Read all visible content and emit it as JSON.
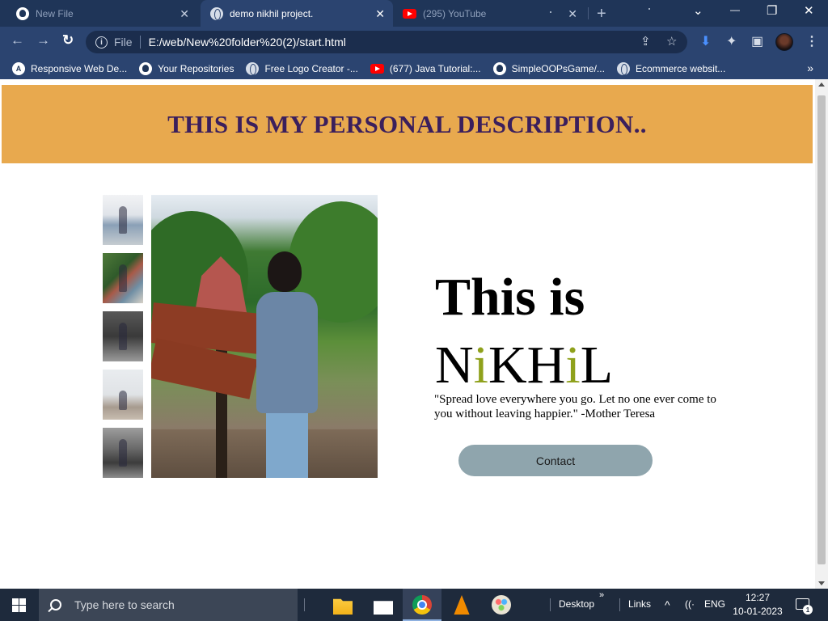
{
  "browser": {
    "tabs": [
      {
        "title": "New File",
        "icon": "github-icon",
        "active": false
      },
      {
        "title": "demo nikhil project.",
        "icon": "globe-icon",
        "active": true
      },
      {
        "title": "(295) YouTube",
        "icon": "youtube-icon",
        "active": false
      }
    ],
    "tab_close_glyph": "✕",
    "new_tab_glyph": "+",
    "window_controls": {
      "dropdown": "⌄",
      "minimize": "—",
      "restore": "❐",
      "close": "✕"
    },
    "nav": {
      "back": "←",
      "forward": "→",
      "reload": "↻"
    },
    "address_bar": {
      "scheme": "File",
      "url": "E:/web/New%20folder%20(2)/start.html"
    },
    "toolbar_icons": {
      "share": "⇪",
      "bookmark_star": "☆",
      "download": "⬇",
      "extensions": "✦",
      "side_panel": "▣",
      "menu": "⋮"
    },
    "bookmarks": [
      {
        "label": "Responsive Web De...",
        "icon": "a-icon"
      },
      {
        "label": "Your Repositories",
        "icon": "github-icon"
      },
      {
        "label": "Free Logo Creator -...",
        "icon": "globe-icon"
      },
      {
        "label": "(677) Java Tutorial:...",
        "icon": "youtube-icon"
      },
      {
        "label": "SimpleOOPsGame/...",
        "icon": "github-icon"
      },
      {
        "label": "Ecommerce websit...",
        "icon": "globe-icon"
      }
    ],
    "bookmarks_more": "»"
  },
  "page": {
    "banner_title": "THIS IS MY PERSONAL DESCRIPTION..",
    "hero_line1": "This is",
    "hero_name": {
      "p1": "N",
      "g1": "i",
      "p2": "KH",
      "g2": "i",
      "p3": "L"
    },
    "quote": "\"Spread love everywhere you go. Let no one ever come to you without leaving happier.\" -Mother Teresa",
    "contact_label": "Contact",
    "accent_banner": "#e8a94e",
    "accent_title": "#3b1f5c",
    "accent_name": "#8fa11c",
    "accent_button": "#8fa5ad"
  },
  "taskbar": {
    "search_placeholder": "Type here to search",
    "desktop_label": "Desktop",
    "links_label": "Links",
    "chevron": "»",
    "tray_up": "^",
    "language": "ENG",
    "time": "12:27",
    "date": "10-01-2023",
    "notification_count": "1"
  }
}
